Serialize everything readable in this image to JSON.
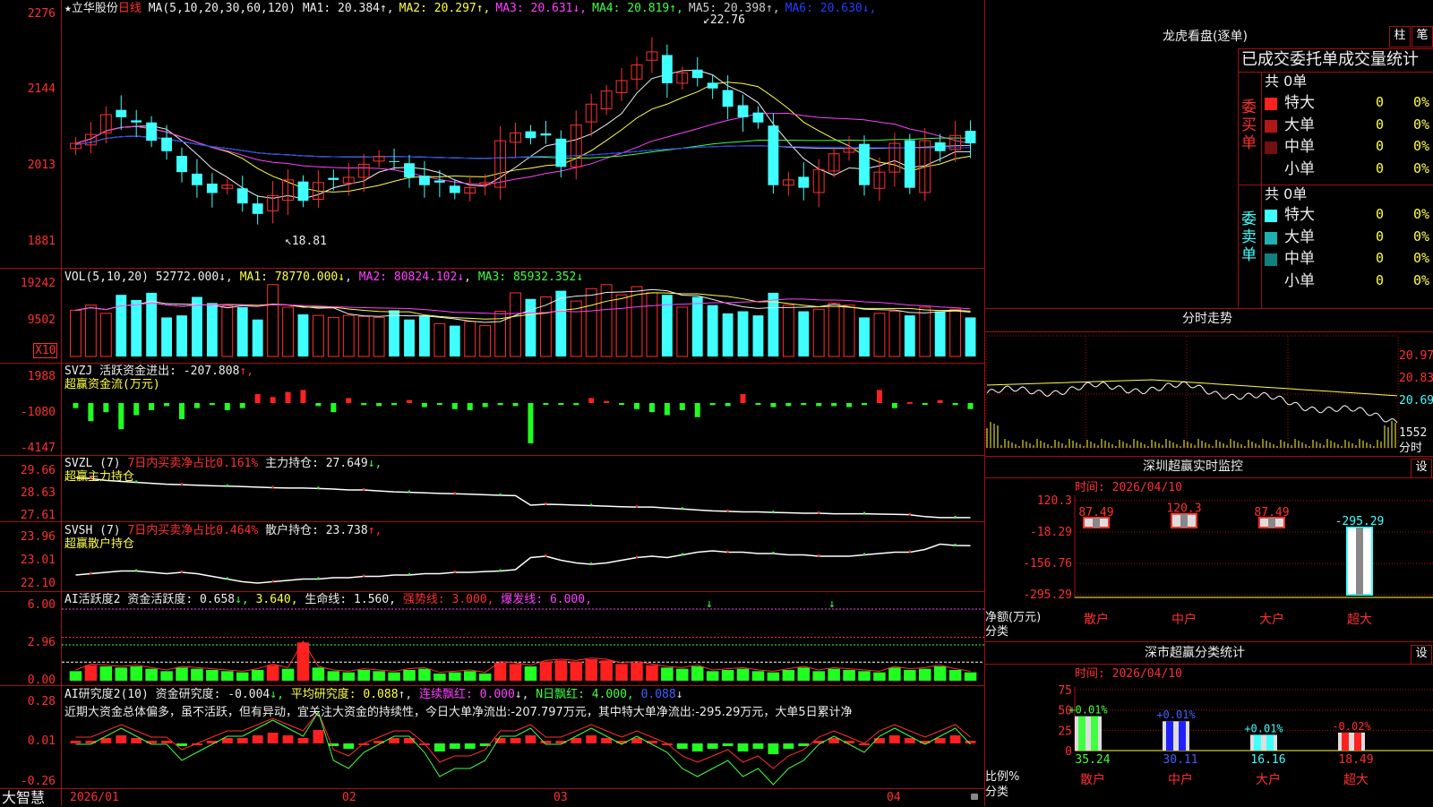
{
  "stock": {
    "star": "★",
    "name": "立华股份",
    "period": "日线"
  },
  "kline": {
    "ma_params": "MA(5,10,20,30,60,120)",
    "mas": [
      {
        "label": "MA1:",
        "value": "20.384",
        "arrow": "↑",
        "color": "#eeeeee"
      },
      {
        "label": "MA2:",
        "value": "20.297",
        "arrow": "↑",
        "color": "#ffff40"
      },
      {
        "label": "MA3:",
        "value": "20.631",
        "arrow": "↓",
        "color": "#ff40ff"
      },
      {
        "label": "MA4:",
        "value": "20.819",
        "arrow": "↑",
        "color": "#40ff40"
      },
      {
        "label": "MA5:",
        "value": "20.398",
        "arrow": "↑",
        "color": "#cccccc"
      },
      {
        "label": "MA6:",
        "value": "20.630",
        "arrow": "↓",
        "color": "#2040ff"
      }
    ],
    "axis": [
      "2276",
      "2144",
      "2013",
      "1881"
    ],
    "high_label": "22.76",
    "low_label": "18.81",
    "closes": [
      20.55,
      20.72,
      21.1,
      21.05,
      20.95,
      20.6,
      20.4,
      20.0,
      19.75,
      19.6,
      19.75,
      19.4,
      19.2,
      19.55,
      19.85,
      19.45,
      19.8,
      19.85,
      19.9,
      20.15,
      20.3,
      20.2,
      19.9,
      19.75,
      19.8,
      19.6,
      19.7,
      19.8,
      20.6,
      20.75,
      20.65,
      20.7,
      20.1,
      20.9,
      21.3,
      21.55,
      21.75,
      22.05,
      22.3,
      21.7,
      21.9,
      21.8,
      21.6,
      21.25,
      21.05,
      20.95,
      19.75,
      19.85,
      19.7,
      20.05,
      20.35,
      20.45,
      19.75,
      20.0,
      20.55,
      19.7,
      20.6,
      20.4,
      20.7,
      20.55
    ]
  },
  "vol": {
    "title": "VOL(5,10,20)",
    "value": "52772.000",
    "arrow": "↓",
    "ma1": "MA1: 78770.000↓",
    "ma2": "MA2: 80824.102↓",
    "ma3": "MA3: 85932.352↓",
    "axis": [
      "19242",
      "9502"
    ],
    "unit": "X10",
    "values": [
      45,
      50,
      42,
      60,
      55,
      62,
      38,
      40,
      58,
      52,
      49,
      48,
      36,
      70,
      48,
      41,
      40,
      38,
      40,
      39,
      38,
      45,
      36,
      40,
      32,
      30,
      34,
      30,
      44,
      62,
      56,
      58,
      64,
      54,
      66,
      70,
      60,
      68,
      62,
      60,
      48,
      58,
      50,
      42,
      44,
      40,
      62,
      50,
      44,
      46,
      52,
      50,
      38,
      42,
      44,
      40,
      48,
      44,
      46,
      38
    ]
  },
  "svzj": {
    "title": "SVZJ",
    "label": "活跃资金进出:",
    "value": "-207.808",
    "arrow": "↑,",
    "subtitle": "超赢资金流(万元)",
    "axis": [
      "1988",
      "-1080",
      "-4147"
    ],
    "values": [
      -500,
      -1800,
      -900,
      -2600,
      -1200,
      -700,
      -300,
      -1600,
      -500,
      -200,
      -700,
      -500,
      900,
      600,
      1100,
      1300,
      -300,
      -900,
      500,
      -200,
      -300,
      -200,
      300,
      -400,
      -100,
      -600,
      -700,
      -400,
      -200,
      -300,
      -4000,
      -100,
      -100,
      -200,
      500,
      200,
      -100,
      -600,
      -900,
      -1200,
      -700,
      -1400,
      -200,
      -300,
      900,
      -100,
      -400,
      -300,
      -200,
      -300,
      -300,
      -400,
      -200,
      1300,
      -500,
      100,
      -100,
      300,
      -200,
      -600,
      -1100,
      -500,
      -300
    ]
  },
  "svzl": {
    "title": "SVZL (7)",
    "label1": "7日内买卖净占比0.161%",
    "label2": "主力持仓: 27.649",
    "arrow": "↓,",
    "subtitle": "超赢主力持仓",
    "axis": [
      "29.66",
      "28.63",
      "27.61"
    ],
    "values": [
      29.75,
      29.7,
      29.6,
      29.55,
      29.5,
      29.45,
      29.4,
      29.38,
      29.35,
      29.32,
      29.3,
      29.28,
      29.25,
      29.22,
      29.2,
      29.2,
      29.18,
      29.15,
      29.1,
      29.1,
      29.05,
      29.0,
      28.98,
      28.95,
      28.92,
      28.9,
      28.88,
      28.85,
      28.82,
      28.8,
      28.3,
      28.35,
      28.33,
      28.3,
      28.28,
      28.25,
      28.22,
      28.2,
      28.2,
      28.15,
      28.1,
      28.05,
      28.0,
      27.98,
      27.95,
      27.95,
      27.92,
      27.9,
      27.88,
      27.88,
      27.85,
      27.85,
      27.85,
      27.83,
      27.82,
      27.8,
      27.7,
      27.65,
      27.65,
      27.65
    ]
  },
  "svsh": {
    "title": "SVSH (7)",
    "label1": "7日内买卖净占比0.464%",
    "label2": "散户持仓: 23.738",
    "arrow": "↑,",
    "subtitle": "超赢散户持仓",
    "axis": [
      "23.96",
      "23.01",
      "22.10"
    ],
    "values": [
      22.65,
      22.7,
      22.75,
      22.8,
      22.8,
      22.75,
      22.7,
      22.75,
      22.7,
      22.6,
      22.5,
      22.4,
      22.35,
      22.4,
      22.45,
      22.5,
      22.5,
      22.55,
      22.55,
      22.6,
      22.6,
      22.65,
      22.65,
      22.7,
      22.7,
      22.75,
      22.75,
      22.78,
      22.8,
      22.85,
      23.3,
      23.35,
      23.2,
      23.1,
      23.05,
      23.1,
      23.2,
      23.3,
      23.35,
      23.3,
      23.4,
      23.5,
      23.55,
      23.5,
      23.5,
      23.45,
      23.45,
      23.4,
      23.4,
      23.35,
      23.35,
      23.35,
      23.4,
      23.45,
      23.5,
      23.5,
      23.6,
      23.8,
      23.75,
      23.74
    ]
  },
  "ai_active": {
    "title": "AI活跃度2",
    "label": "资金活跃度: 0.658",
    "arrow": "↓,",
    "v2": "3.640,",
    "life": "生命线: 1.560,",
    "strong": "强势线: 3.000,",
    "burst": "爆发线: 6.000,",
    "axis": [
      "6.00",
      "2.96",
      "0.00"
    ],
    "values": [
      0.8,
      1.3,
      1.2,
      1.1,
      1.2,
      1.0,
      0.8,
      1.1,
      1.0,
      0.9,
      0.8,
      0.7,
      0.9,
      1.3,
      1.0,
      3.2,
      1.1,
      0.8,
      0.7,
      0.9,
      0.8,
      0.7,
      0.9,
      1.0,
      0.6,
      0.7,
      0.8,
      0.6,
      1.5,
      1.4,
      1.2,
      1.6,
      1.7,
      1.6,
      1.8,
      1.7,
      1.4,
      1.5,
      1.3,
      1.1,
      1.0,
      1.2,
      0.8,
      0.9,
      1.0,
      0.8,
      0.7,
      0.9,
      1.1,
      0.8,
      1.0,
      0.9,
      0.8,
      0.7,
      1.1,
      0.9,
      1.0,
      1.2,
      0.9,
      0.7
    ]
  },
  "ai_research": {
    "title": "AI研究度2(10)",
    "label": "资金研究度: -0.004",
    "arrow": "↓,",
    "avg": "平均研究度: 0.088",
    "cont": "连续飘红: 0.000",
    "nday": "N日飘红: 4.000,",
    "last": "0.088",
    "axis": [
      "0.28",
      "0.01",
      "-0.26"
    ],
    "note": "近期大资金总体偏多，虽不活跃，但有异动，宜关注大资金的持续性，今日大单净流出:-207.797万元，其中特大单净流出:-295.29万元，大单5日累计净",
    "values": [
      0.01,
      0.01,
      0.02,
      0.03,
      0.02,
      0.01,
      0.01,
      -0.01,
      0.0,
      0.01,
      0.02,
      0.02,
      0.03,
      0.04,
      0.03,
      0.02,
      0.05,
      -0.01,
      -0.02,
      0.0,
      0.01,
      0.02,
      0.02,
      0.0,
      -0.03,
      -0.02,
      -0.02,
      -0.01,
      0.02,
      0.02,
      0.03,
      0.01,
      0.01,
      0.02,
      0.03,
      0.02,
      0.01,
      0.02,
      0.01,
      0.0,
      -0.02,
      -0.03,
      -0.02,
      -0.01,
      -0.03,
      -0.02,
      -0.04,
      -0.02,
      -0.01,
      0.01,
      0.02,
      0.01,
      0.0,
      0.02,
      0.03,
      0.02,
      0.01,
      0.02,
      0.03,
      0.01
    ]
  },
  "dates": {
    "start": "2026/01",
    "m2": "02",
    "m3": "03",
    "m4": "04"
  },
  "brand": "大智慧",
  "dragon": {
    "title": "龙虎看盘(逐单)",
    "tab1": "柱",
    "tab2": "笔",
    "header": "已成交委托单成交量统计",
    "buy_side_label": "委买单",
    "sell_side_label": "委卖单",
    "buy_total": "共 0单",
    "sell_total": "共 0单",
    "buy_rows": [
      {
        "name": "特大",
        "count": "0",
        "pct": "0%",
        "color": "#ff2020"
      },
      {
        "name": "大单",
        "count": "0",
        "pct": "0%",
        "color": "#b01818"
      },
      {
        "name": "中单",
        "count": "0",
        "pct": "0%",
        "color": "#701010"
      },
      {
        "name": "小单",
        "count": "0",
        "pct": "0%",
        "color": "#000000"
      }
    ],
    "sell_rows": [
      {
        "name": "特大",
        "count": "0",
        "pct": "0%",
        "color": "#40ffff"
      },
      {
        "name": "大单",
        "count": "0",
        "pct": "0%",
        "color": "#20b0b0"
      },
      {
        "name": "中单",
        "count": "0",
        "pct": "0%",
        "color": "#108080"
      },
      {
        "name": "小单",
        "count": "0",
        "pct": "0%",
        "color": "#000000"
      }
    ]
  },
  "intraday": {
    "title": "分时走势",
    "prices": [
      "20.97",
      "20.83",
      "20.69"
    ],
    "vol_label": "1552",
    "vol_unit": "分时"
  },
  "monitor": {
    "title": "深圳超赢实时监控",
    "btn": "设",
    "date": "时间: 2026/04/10",
    "axis": [
      "120.3",
      "-18.29",
      "-156.76",
      "-295.29"
    ],
    "unit1": "净额(万元)",
    "unit2": "分类",
    "bars": [
      {
        "cat": "散户",
        "label": "87.49",
        "value": 87.49
      },
      {
        "cat": "中户",
        "label": "120.3",
        "value": 120.3
      },
      {
        "cat": "大户",
        "label": "87.49",
        "value": 87.49
      },
      {
        "cat": "超大",
        "label": "-295.29",
        "value": -295.29
      }
    ]
  },
  "stats": {
    "title": "深市超赢分类统计",
    "btn": "设",
    "date": "时间: 2026/04/10",
    "axis": [
      "75",
      "50",
      "25",
      "0"
    ],
    "unit1": "比例%",
    "unit2": "分类",
    "bars": [
      {
        "cat": "散户",
        "value": 35.24,
        "label": "35.24",
        "chg": "+0.01%",
        "color": "#40ff40",
        "catcolor": "#ff3030",
        "valcolor": "#40ff40"
      },
      {
        "cat": "中户",
        "value": 30.11,
        "label": "30.11",
        "chg": "+0.01%",
        "color": "#2020ff",
        "catcolor": "#ff3030",
        "valcolor": "#4060ff"
      },
      {
        "cat": "大户",
        "value": 16.16,
        "label": "16.16",
        "chg": "+0.01%",
        "color": "#40ffff",
        "catcolor": "#ff3030",
        "valcolor": "#40ffff"
      },
      {
        "cat": "超大",
        "value": 18.49,
        "label": "18.49",
        "chg": "-0.02%",
        "color": "#ff2020",
        "catcolor": "#ff3030",
        "valcolor": "#ff3030"
      }
    ]
  }
}
